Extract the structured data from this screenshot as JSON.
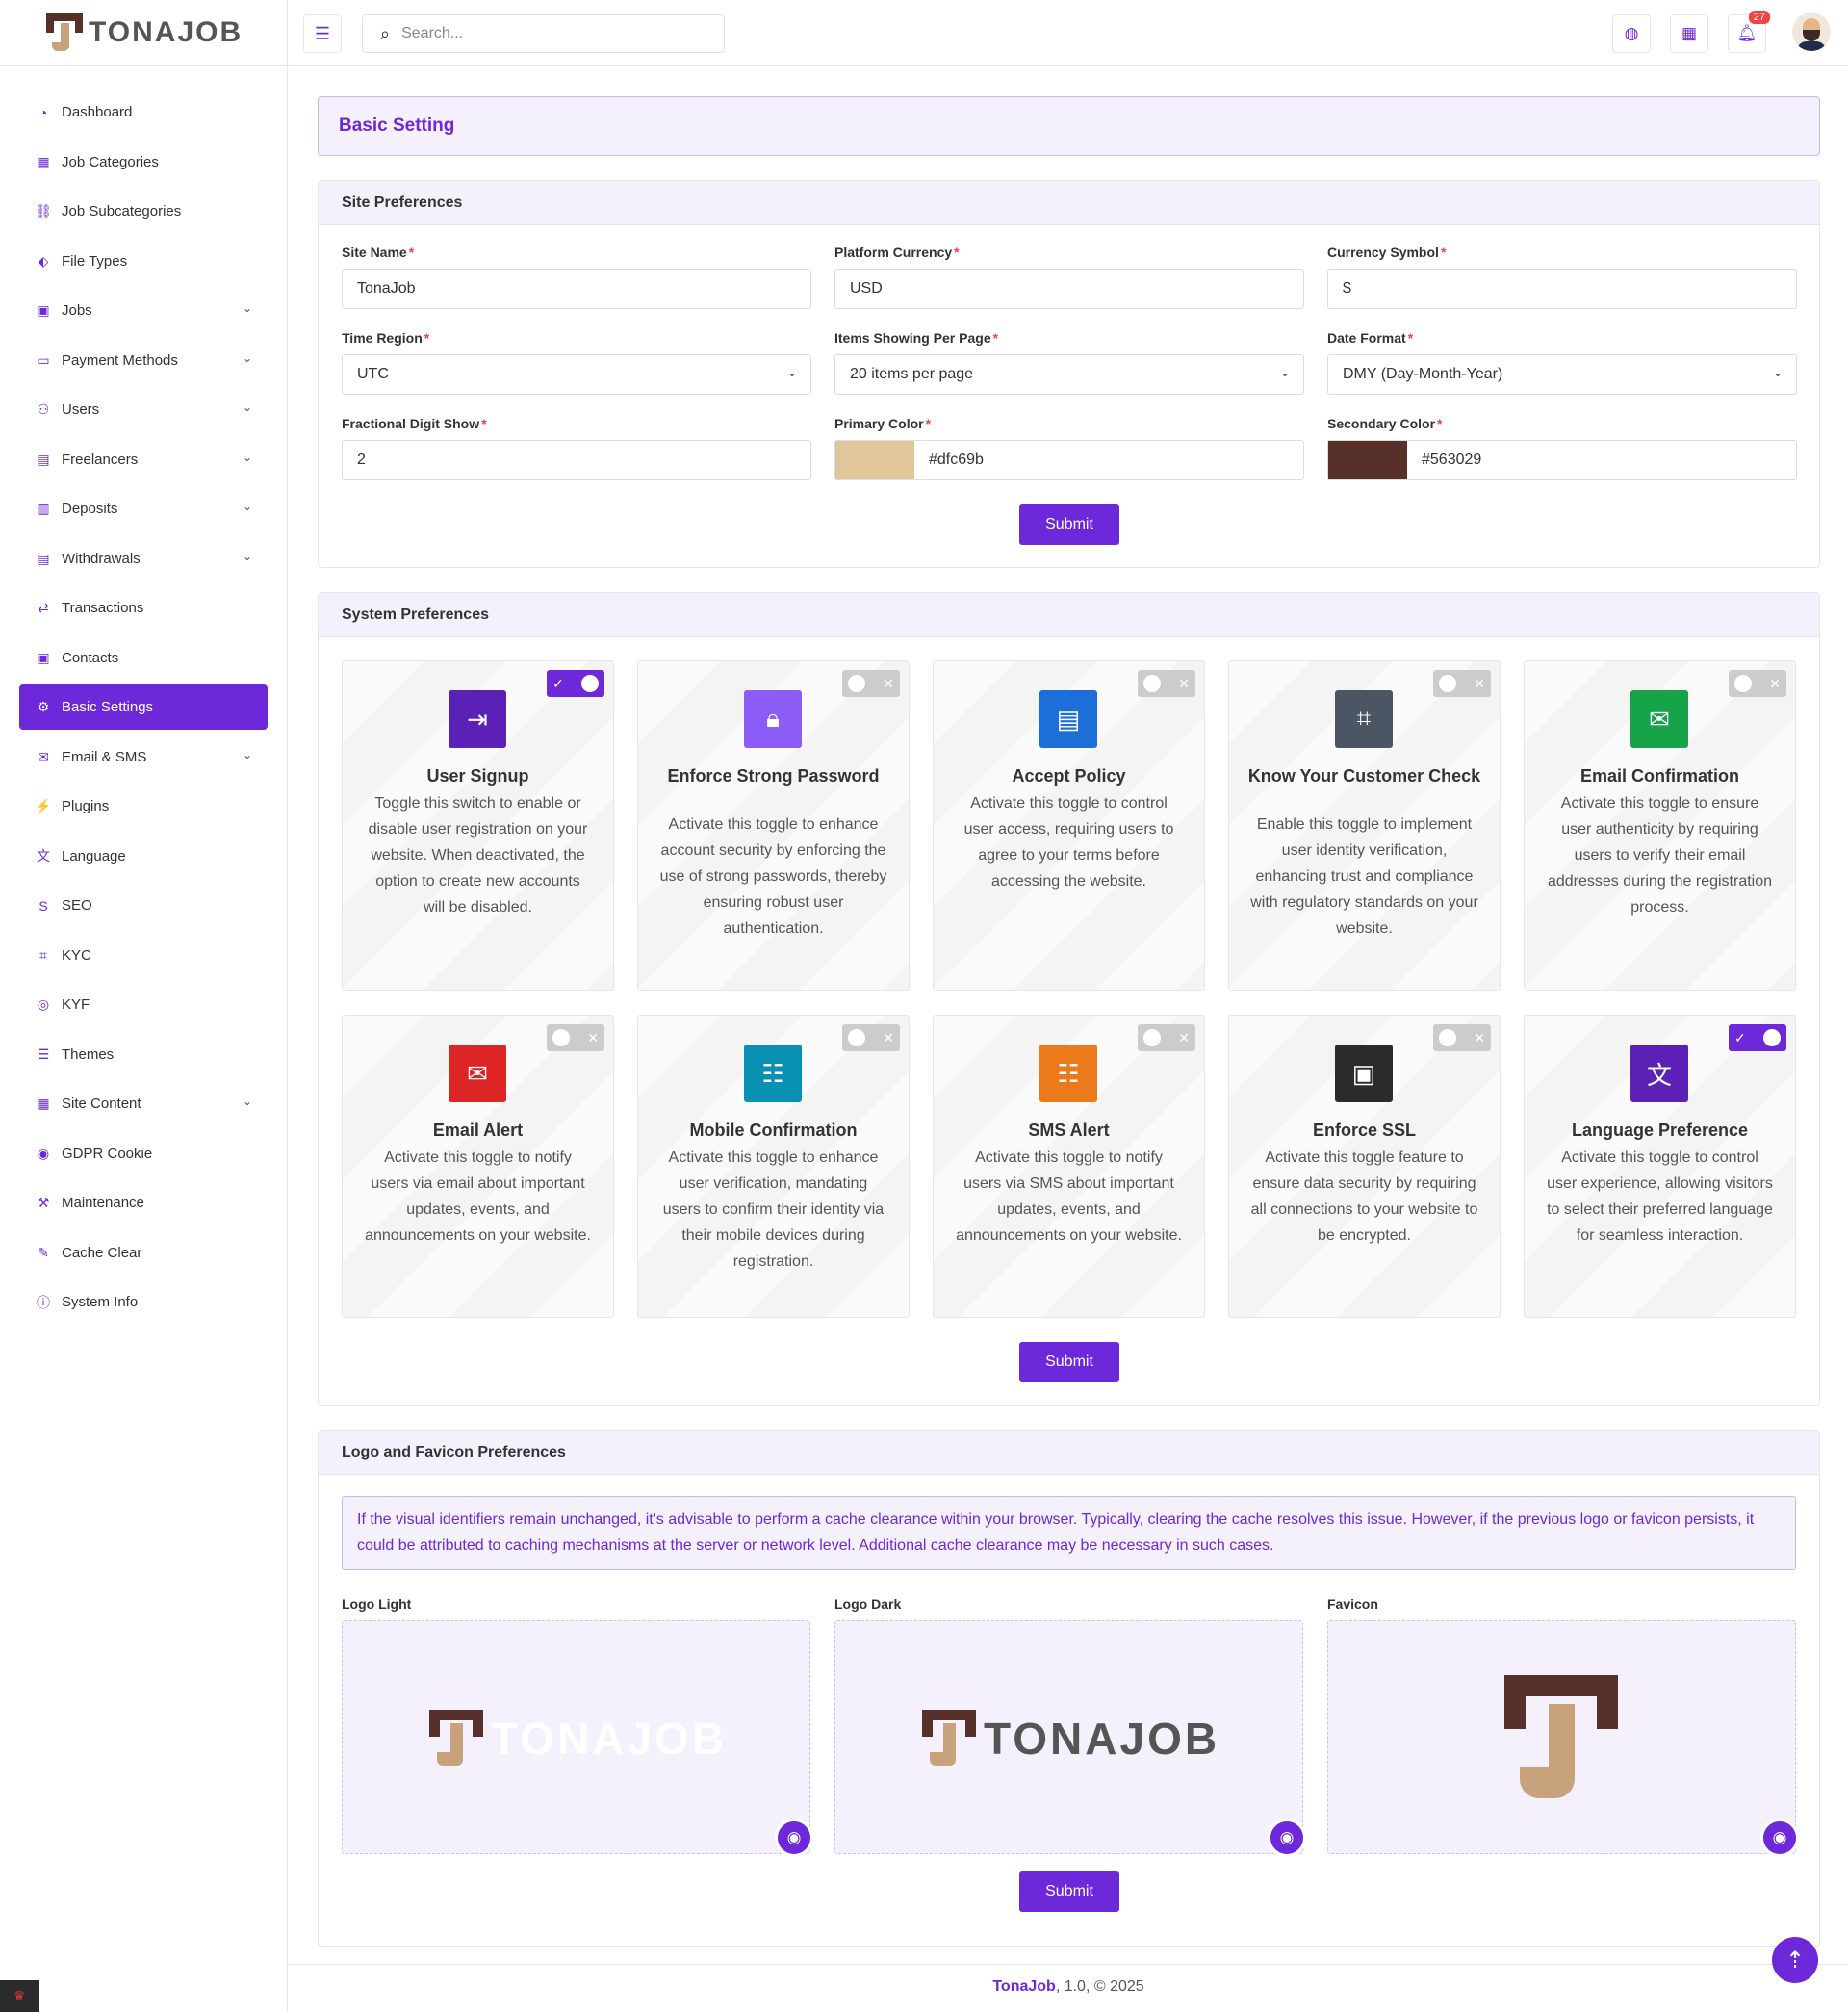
{
  "app": {
    "brand": "TONAJOB",
    "search_placeholder": "Search...",
    "notification_count": "27"
  },
  "sidebar": {
    "items": [
      {
        "label": "Dashboard",
        "icon": "dashboard-icon",
        "expandable": false
      },
      {
        "label": "Job Categories",
        "icon": "grid-icon",
        "expandable": false
      },
      {
        "label": "Job Subcategories",
        "icon": "hierarchy-icon",
        "expandable": false
      },
      {
        "label": "File Types",
        "icon": "tag-icon",
        "expandable": false
      },
      {
        "label": "Jobs",
        "icon": "jobs-icon",
        "expandable": true
      },
      {
        "label": "Payment Methods",
        "icon": "card-icon",
        "expandable": true
      },
      {
        "label": "Users",
        "icon": "users-icon",
        "expandable": true
      },
      {
        "label": "Freelancers",
        "icon": "freelancers-icon",
        "expandable": true
      },
      {
        "label": "Deposits",
        "icon": "wallet-icon",
        "expandable": true
      },
      {
        "label": "Withdrawals",
        "icon": "bank-icon",
        "expandable": true
      },
      {
        "label": "Transactions",
        "icon": "swap-icon",
        "expandable": false
      },
      {
        "label": "Contacts",
        "icon": "contacts-icon",
        "expandable": false
      },
      {
        "label": "Basic Settings",
        "icon": "gear-icon",
        "expandable": false,
        "active": true
      },
      {
        "label": "Email & SMS",
        "icon": "mail-icon",
        "expandable": true
      },
      {
        "label": "Plugins",
        "icon": "plug-icon",
        "expandable": false
      },
      {
        "label": "Language",
        "icon": "translate-icon",
        "expandable": false
      },
      {
        "label": "SEO",
        "icon": "seo-icon",
        "expandable": false
      },
      {
        "label": "KYC",
        "icon": "scan-icon",
        "expandable": false
      },
      {
        "label": "KYF",
        "icon": "badge-icon",
        "expandable": false
      },
      {
        "label": "Themes",
        "icon": "themes-icon",
        "expandable": false
      },
      {
        "label": "Site Content",
        "icon": "content-icon",
        "expandable": true
      },
      {
        "label": "GDPR Cookie",
        "icon": "cookie-icon",
        "expandable": false
      },
      {
        "label": "Maintenance",
        "icon": "wrench-icon",
        "expandable": false
      },
      {
        "label": "Cache Clear",
        "icon": "broom-icon",
        "expandable": false
      },
      {
        "label": "System Info",
        "icon": "info-icon",
        "expandable": false
      }
    ]
  },
  "page": {
    "title": "Basic Setting"
  },
  "site_preferences": {
    "title": "Site Preferences",
    "site_name_label": "Site Name",
    "site_name": "TonaJob",
    "currency_label": "Platform Currency",
    "currency": "USD",
    "symbol_label": "Currency Symbol",
    "symbol": "$",
    "time_region_label": "Time Region",
    "time_region": "UTC",
    "items_label": "Items Showing Per Page",
    "items": "20 items per page",
    "date_format_label": "Date Format",
    "date_format": "DMY (Day-Month-Year)",
    "fraction_label": "Fractional Digit Show",
    "fraction": "2",
    "primary_label": "Primary Color",
    "primary": "#dfc69b",
    "secondary_label": "Secondary Color",
    "secondary": "#563029",
    "submit": "Submit"
  },
  "system_preferences": {
    "title": "System Preferences",
    "submit": "Submit",
    "cards": [
      {
        "title": "User Signup",
        "on": true,
        "color": "#5b21b6",
        "icon": "signup-icon",
        "desc": "Toggle this switch to enable or disable user registration on your website. When deactivated, the option to create new accounts will be disabled."
      },
      {
        "title": "Enforce Strong Password",
        "on": false,
        "color": "#8b5cf6",
        "icon": "lock-icon",
        "desc": "Activate this toggle to enhance account security by enforcing the use of strong passwords, thereby ensuring robust user authentication."
      },
      {
        "title": "Accept Policy",
        "on": false,
        "color": "#1d6fd8",
        "icon": "clipboard-icon",
        "desc": "Activate this toggle to control user access, requiring users to agree to your terms before accessing the website."
      },
      {
        "title": "Know Your Customer Check",
        "on": false,
        "color": "#4b5563",
        "icon": "face-scan-icon",
        "desc": "Enable this toggle to implement user identity verification, enhancing trust and compliance with regulatory standards on your website."
      },
      {
        "title": "Email Confirmation",
        "on": false,
        "color": "#16a34a",
        "icon": "mail-check-icon",
        "desc": "Activate this toggle to ensure user authenticity by requiring users to verify their email addresses during the registration process."
      },
      {
        "title": "Email Alert",
        "on": false,
        "color": "#dc2626",
        "icon": "mail-alert-icon",
        "desc": "Activate this toggle to notify users via email about important updates, events, and announcements on your website."
      },
      {
        "title": "Mobile Confirmation",
        "on": false,
        "color": "#0891b2",
        "icon": "message-check-icon",
        "desc": "Activate this toggle to enhance user verification, mandating users to confirm their identity via their mobile devices during registration."
      },
      {
        "title": "SMS Alert",
        "on": false,
        "color": "#ea7a1a",
        "icon": "sms-alert-icon",
        "desc": "Activate this toggle to notify users via SMS about important updates, events, and announcements on your website."
      },
      {
        "title": "Enforce SSL",
        "on": false,
        "color": "#2b2b2b",
        "icon": "certificate-icon",
        "desc": "Activate this toggle feature to ensure data security by requiring all connections to your website to be encrypted."
      },
      {
        "title": "Language Preference",
        "on": true,
        "color": "#5b21b6",
        "icon": "translate-icon",
        "desc": "Activate this toggle to control user experience, allowing visitors to select their preferred language for seamless interaction."
      }
    ]
  },
  "logo_preferences": {
    "title": "Logo and Favicon Preferences",
    "notice": "If the visual identifiers remain unchanged, it's advisable to perform a cache clearance within your browser. Typically, clearing the cache resolves this issue. However, if the previous logo or favicon persists, it could be attributed to caching mechanisms at the server or network level. Additional cache clearance may be necessary in such cases.",
    "logo_light_label": "Logo Light",
    "logo_dark_label": "Logo Dark",
    "favicon_label": "Favicon",
    "logo_text": "TONAJOB",
    "submit": "Submit"
  },
  "footer": {
    "brand": "TonaJob",
    "rest": ", 1.0, © 2025"
  }
}
